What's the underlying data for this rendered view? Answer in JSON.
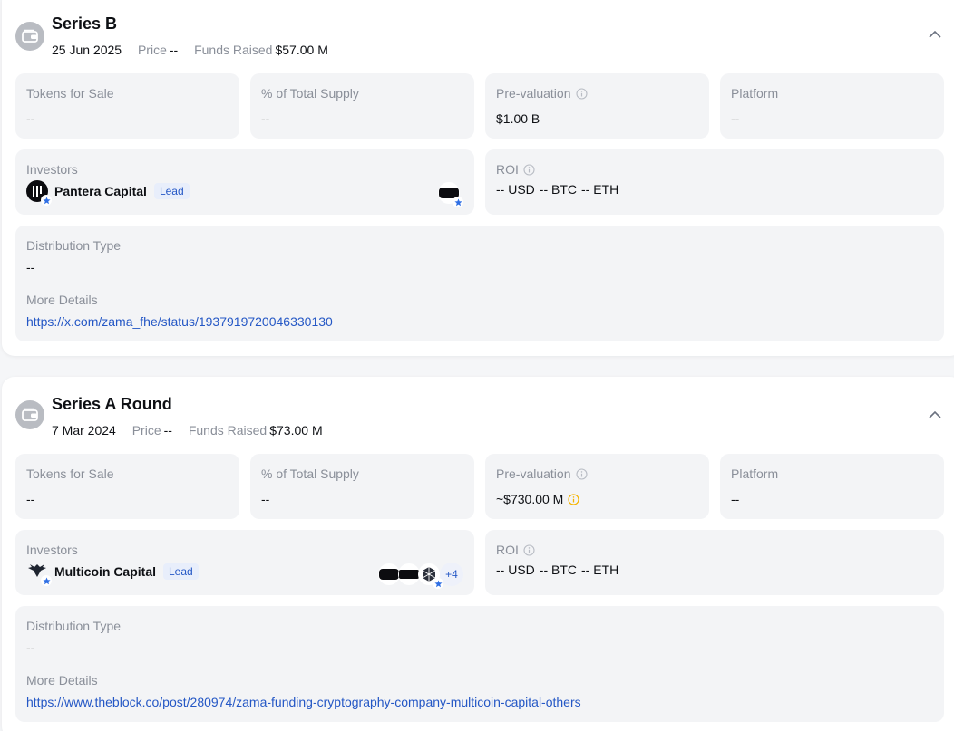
{
  "colors": {
    "accent": "#2457c5",
    "muted": "#8a8f99",
    "panel": "#f3f4f6",
    "warning": "#f5b400"
  },
  "labels": {
    "price": "Price",
    "funds_raised": "Funds Raised",
    "tokens_for_sale": "Tokens for Sale",
    "pct_total_supply": "% of Total Supply",
    "pre_valuation": "Pre-valuation",
    "platform": "Platform",
    "investors": "Investors",
    "roi": "ROI",
    "distribution_type": "Distribution Type",
    "more_details": "More Details",
    "lead": "Lead",
    "usd": "USD",
    "btc": "BTC",
    "eth": "ETH",
    "empty": "--"
  },
  "rounds": [
    {
      "title": "Series B",
      "date": "25 Jun 2025",
      "price": "--",
      "funds_raised": "$57.00 M",
      "tokens_for_sale": "--",
      "pct_total_supply": "--",
      "pre_valuation": "$1.00 B",
      "platform": "--",
      "lead_investor": "Pantera Capital",
      "roi": {
        "usd": "--",
        "btc": "--",
        "eth": "--"
      },
      "distribution_type": "--",
      "more_details_url": "https://x.com/zama_fhe/status/1937919720046330130"
    },
    {
      "title": "Series A Round",
      "date": "7 Mar 2024",
      "price": "--",
      "funds_raised": "$73.00 M",
      "tokens_for_sale": "--",
      "pct_total_supply": "--",
      "pre_valuation": "~$730.00 M",
      "platform": "--",
      "lead_investor": "Multicoin Capital",
      "more_investors": "+4",
      "roi": {
        "usd": "--",
        "btc": "--",
        "eth": "--"
      },
      "distribution_type": "--",
      "more_details_url": "https://www.theblock.co/post/280974/zama-funding-cryptography-company-multicoin-capital-others"
    }
  ]
}
